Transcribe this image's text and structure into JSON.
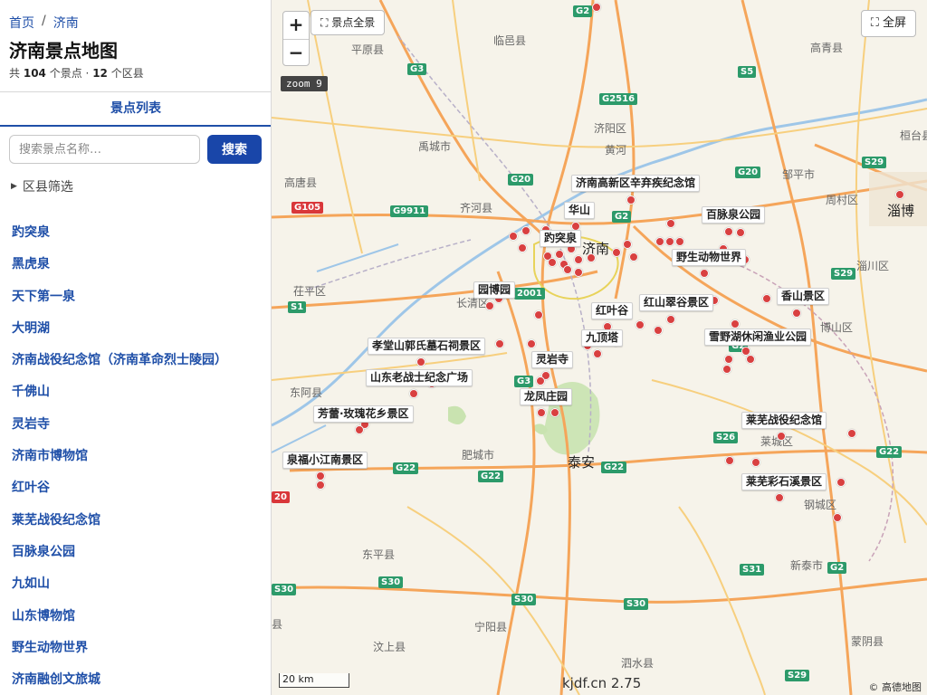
{
  "breadcrumb": {
    "home": "首页",
    "separator": "/",
    "current": "济南"
  },
  "page_title": "济南景点地图",
  "summary": {
    "prefix": "共",
    "poi_count": "104",
    "poi_unit": "个景点 ·",
    "district_count": "12",
    "district_unit": "个区县"
  },
  "tab": {
    "label": "景点列表"
  },
  "search": {
    "placeholder": "搜索景点名称…",
    "button_label": "搜索"
  },
  "filter": {
    "label": "区县筛选"
  },
  "poi_list": [
    "趵突泉",
    "黑虎泉",
    "天下第一泉",
    "大明湖",
    "济南战役纪念馆（济南革命烈士陵园）",
    "千佛山",
    "灵岩寺",
    "济南市博物馆",
    "红叶谷",
    "莱芜战役纪念馆",
    "百脉泉公园",
    "九如山",
    "山东博物馆",
    "野生动物世界",
    "济南融创文旅城"
  ],
  "map": {
    "zoom_in": "+",
    "zoom_out": "−",
    "overview_label": "景点全景",
    "fullscreen_label": "全屏",
    "zoom_badge": "zoom 9",
    "scale_label": "20 km",
    "version": "kjdf.cn 2.75",
    "copyright": "© 高德地图",
    "poi_tags": {
      "xinqiji": "济南高新区辛弃疾纪念馆",
      "huashan": "华山",
      "baotu": "趵突泉",
      "baimai": "百脉泉公园",
      "wildlife": "野生动物世界",
      "yuanbo": "园博园",
      "hongye": "红叶谷",
      "hongshan": "红山翠谷景区",
      "xiangshan": "香山景区",
      "jiuding": "九顶塔",
      "xiaotang": "孝堂山郭氏墓石祠景区",
      "xueye": "雪野湖休闲渔业公园",
      "lingyan": "灵岩寺",
      "laozhanshi": "山东老战士纪念广场",
      "longfeng": "龙凤庄园",
      "fanglei": "芳蕾·玫瑰花乡景区",
      "laiwu_battle": "莱芜战役纪念馆",
      "quanfu": "泉福小江南景区",
      "laiwu_caishi": "莱芜彩石溪景区"
    },
    "cities": {
      "jinan": "济南",
      "taian": "泰安",
      "zibo": "淄博"
    },
    "places": {
      "pingyuan": "平原县",
      "linyi": "临邑县",
      "gaoqing": "高青县",
      "jiyang": "济阳区",
      "yucheng": "禹城市",
      "huanghe": "黄河",
      "zouping": "邹平市",
      "zhoucun": "周村区",
      "huantai": "桓台县",
      "gaotang": "高唐县",
      "qihe": "齐河县",
      "chiping": "茌平区",
      "changqing": "长清区",
      "zichuan": "淄川区",
      "boshan": "博山区",
      "donge": "东阿县",
      "feicheng": "肥城市",
      "laicheng": "莱城区",
      "gangcheng": "钢城区",
      "dongping": "东平县",
      "xintai": "新泰市",
      "ningyang": "宁阳县",
      "wenshang": "汶上县",
      "sishui": "泗水县",
      "mengyin": "蒙阴县",
      "xian": "县"
    },
    "shields": {
      "g2_top": "G2",
      "g3": "G3",
      "s5": "S5",
      "g2516": "G2516",
      "g20_a": "G20",
      "g20_b": "G20",
      "g9911": "G9911",
      "g105": "G105",
      "g2_mid": "G2",
      "s29_a": "S29",
      "s29_b": "S29",
      "s1": "S1",
      "g2001": "2001",
      "g3_b": "G3",
      "s26": "S26",
      "g22_a": "G22",
      "g22_b": "G22",
      "g22_c": "G22",
      "g22_d": "G22",
      "g20_edge": "20",
      "s30_a": "S30",
      "s30_b": "S30",
      "s30_c": "S30",
      "s30_d": "S30",
      "s31": "S31",
      "g2_right": "G2",
      "s29_c": "S29",
      "g2_zibo": "G2"
    },
    "colors": {
      "marker": "#d94040",
      "expressway": "#f5a55a",
      "road": "#f7cf7e",
      "water": "#9ec6e8",
      "green": "#c9e3b0"
    }
  }
}
